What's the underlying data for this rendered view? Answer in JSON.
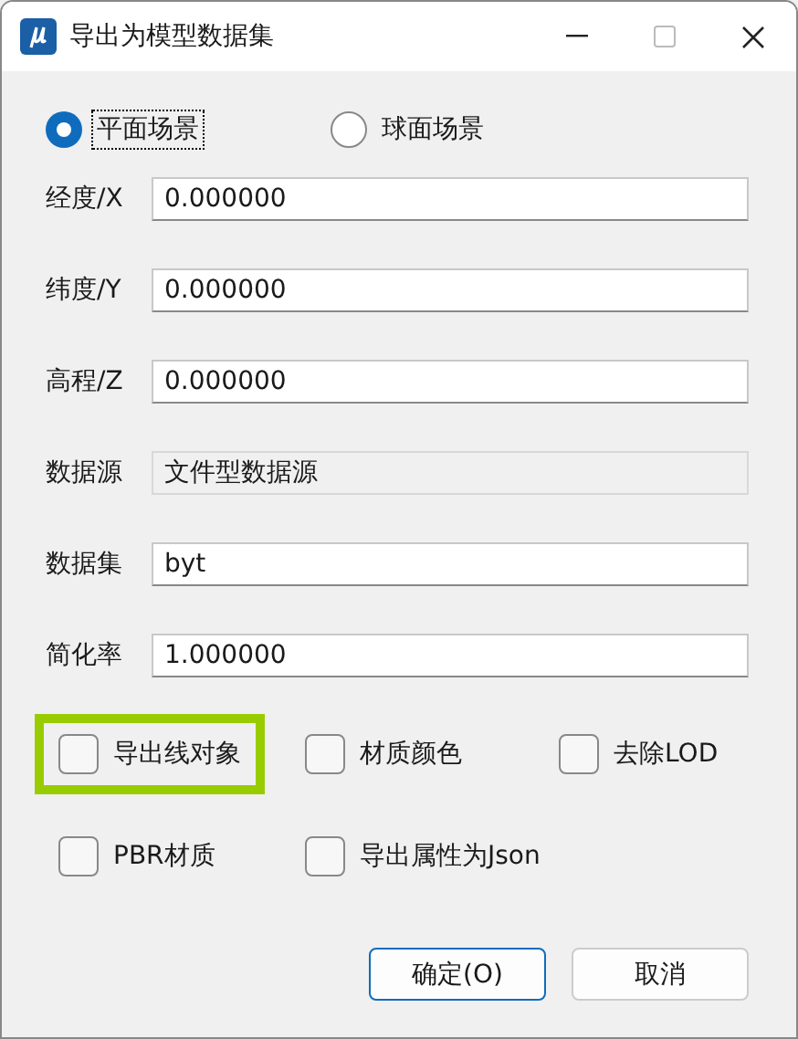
{
  "window": {
    "title": "导出为模型数据集"
  },
  "scene": [
    {
      "label": "平面场景",
      "selected": true
    },
    {
      "label": "球面场景",
      "selected": false
    }
  ],
  "fields": [
    {
      "label": "经度/X",
      "value": "0.000000",
      "readonly": false
    },
    {
      "label": "纬度/Y",
      "value": "0.000000",
      "readonly": false
    },
    {
      "label": "高程/Z",
      "value": "0.000000",
      "readonly": false
    },
    {
      "label": "数据源",
      "value": "文件型数据源",
      "readonly": true
    },
    {
      "label": "数据集",
      "value": "byt",
      "readonly": false
    },
    {
      "label": "简化率",
      "value": "1.000000",
      "readonly": false
    }
  ],
  "options": [
    {
      "label": "导出线对象",
      "checked": false,
      "highlighted": true
    },
    {
      "label": "材质颜色",
      "checked": false,
      "highlighted": false
    },
    {
      "label": "去除LOD",
      "checked": false,
      "highlighted": false
    },
    {
      "label": "PBR材质",
      "checked": false,
      "highlighted": false
    },
    {
      "label": "导出属性为Json",
      "checked": false,
      "highlighted": false
    }
  ],
  "buttons": [
    {
      "label": "确定(O)",
      "default": true
    },
    {
      "label": "取消",
      "default": false
    }
  ]
}
